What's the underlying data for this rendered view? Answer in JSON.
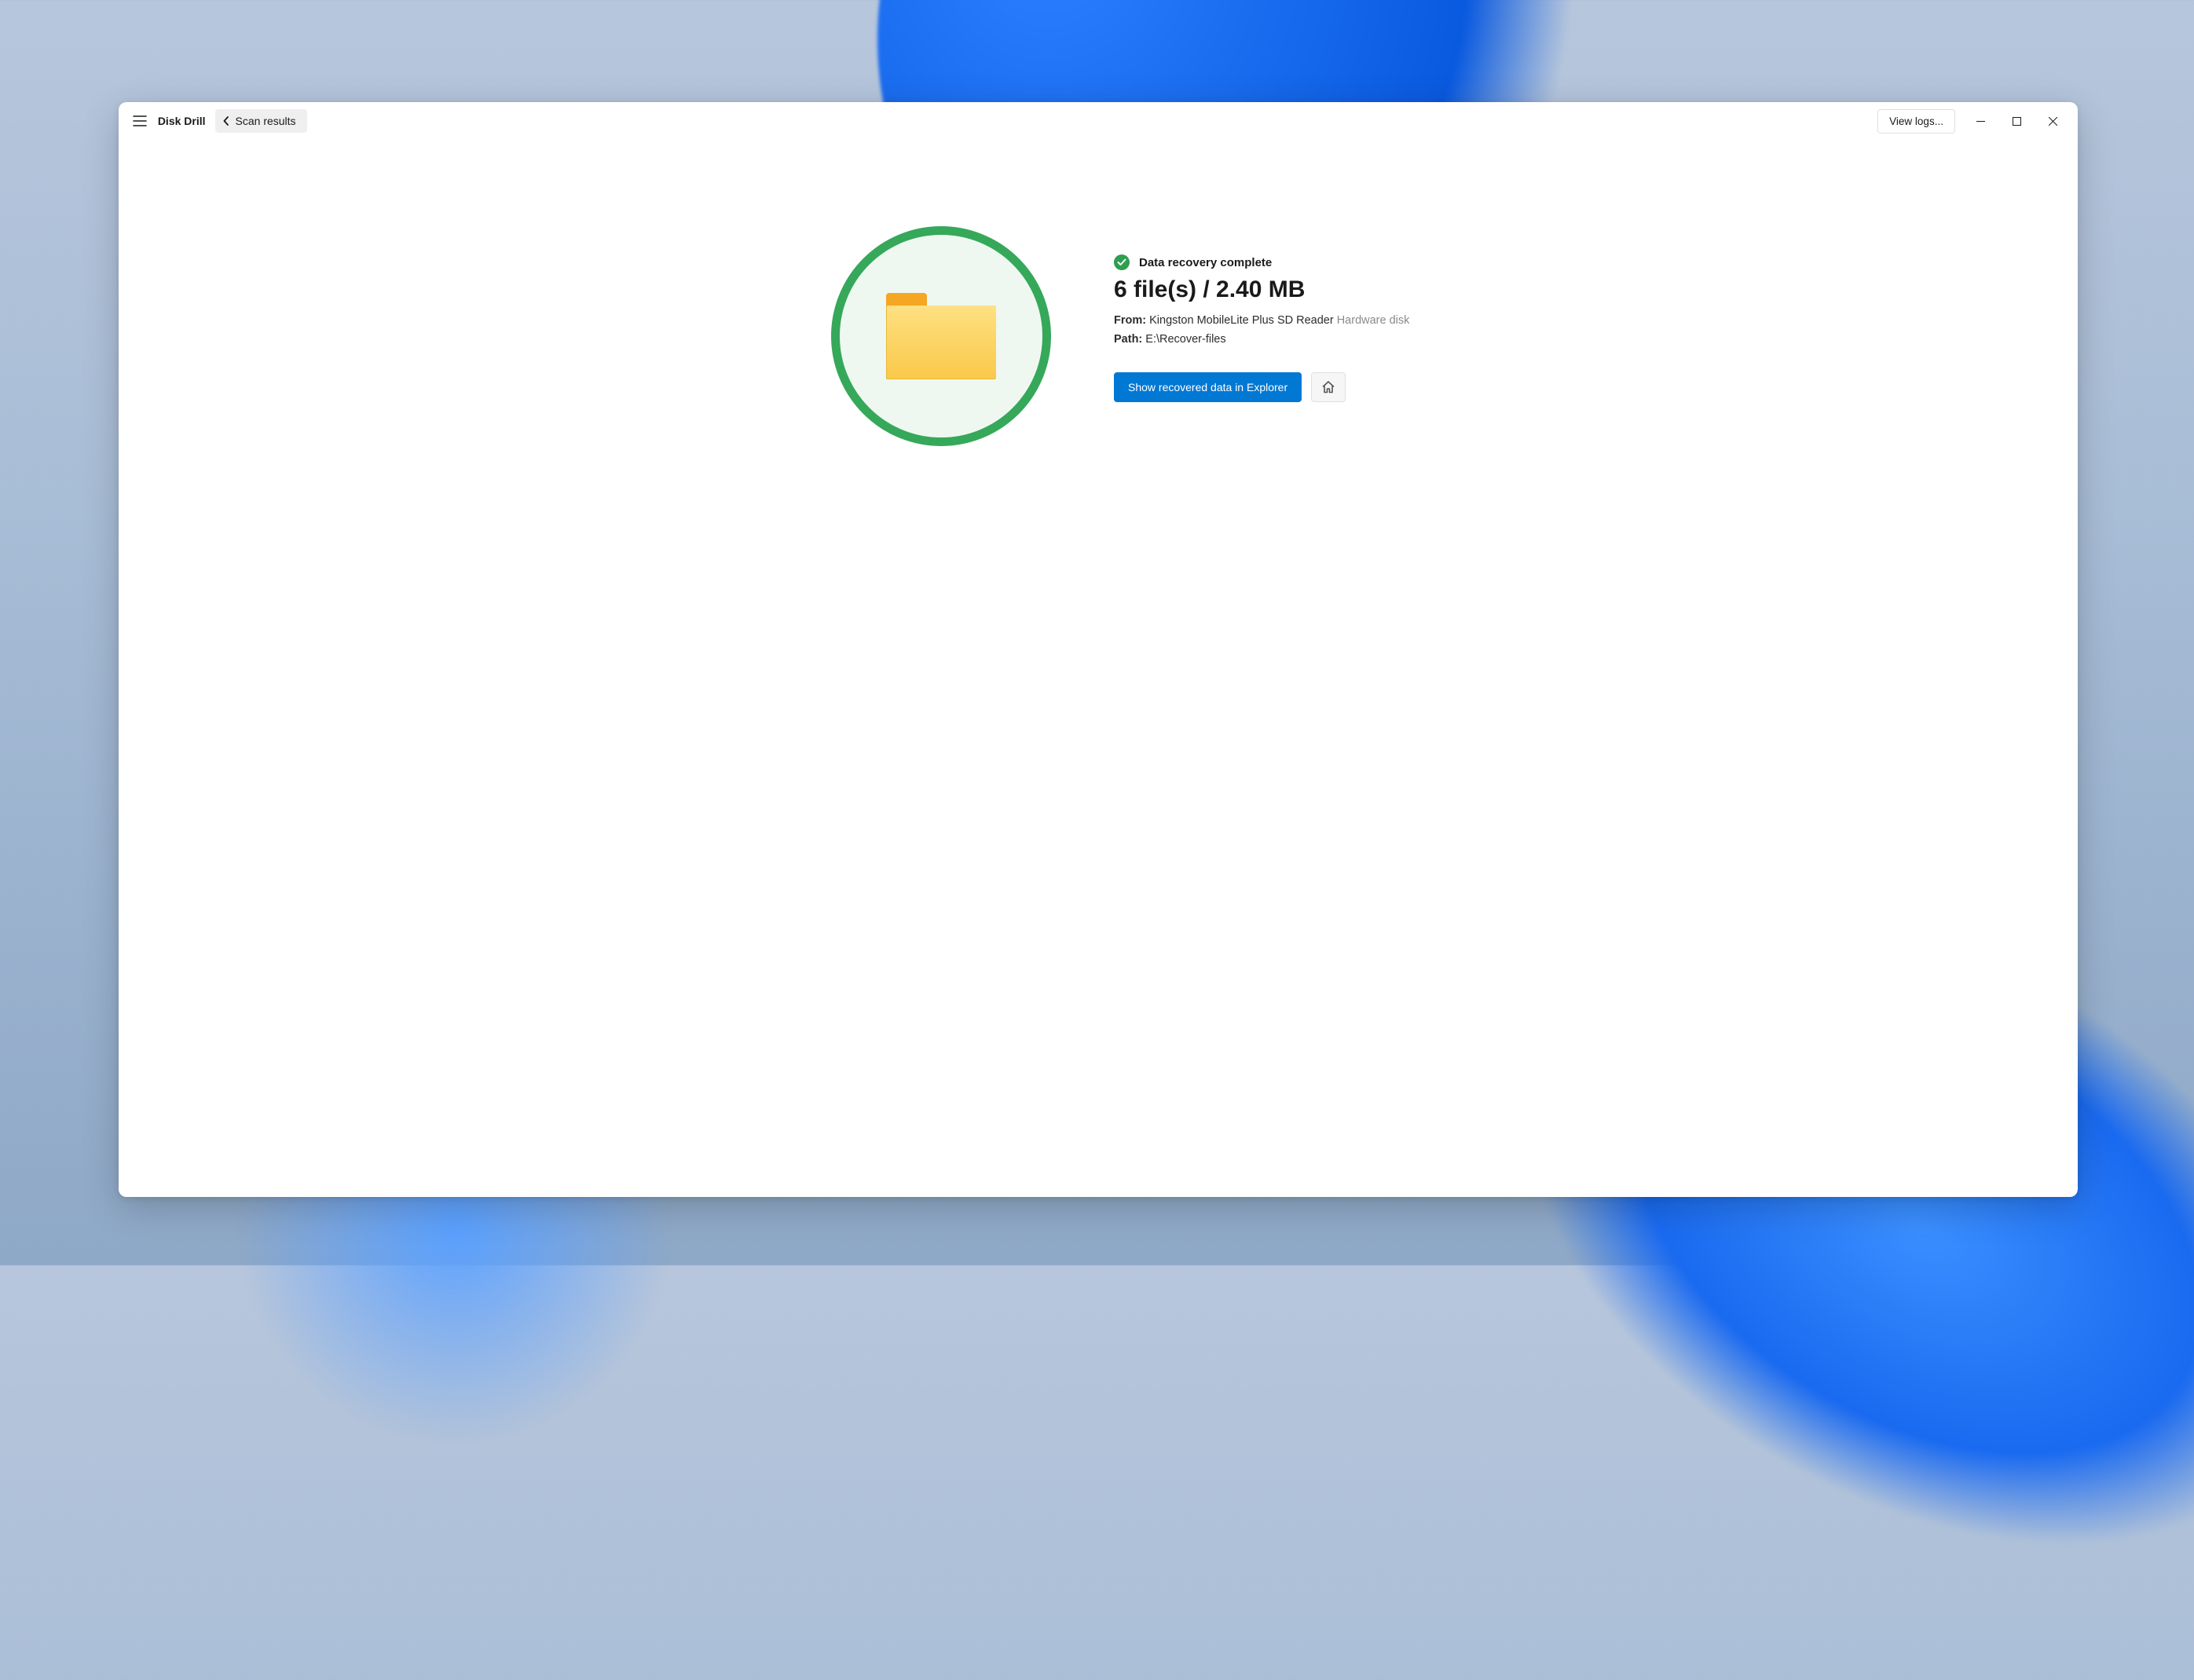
{
  "titlebar": {
    "app_name": "Disk Drill",
    "back_label": "Scan results",
    "view_logs_label": "View logs..."
  },
  "result": {
    "status_text": "Data recovery complete",
    "headline": "6 file(s) / 2.40 MB",
    "from_label": "From:",
    "from_value": "Kingston MobileLite Plus SD Reader",
    "from_suffix": "Hardware disk",
    "path_label": "Path:",
    "path_value": "E:\\Recover-files",
    "primary_button": "Show recovered data in Explorer"
  }
}
